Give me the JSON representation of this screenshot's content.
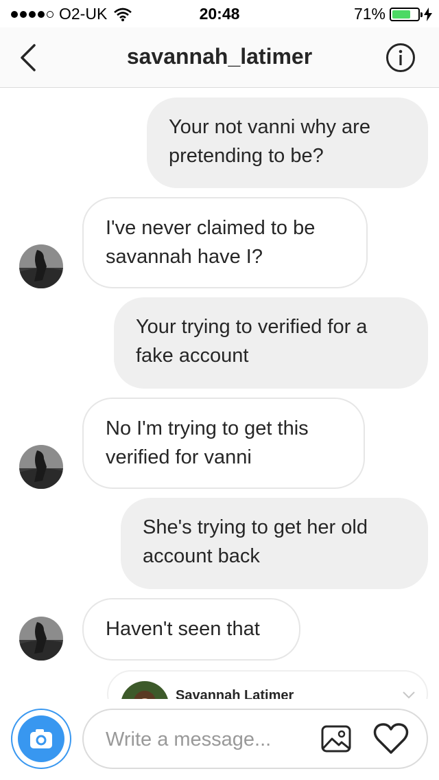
{
  "status_bar": {
    "carrier": "O2-UK",
    "time": "20:48",
    "battery_percent": "71%",
    "battery_level": 0.71,
    "signal_bars": 4
  },
  "header": {
    "title": "savannah_latimer",
    "back_icon": "chevron-left-icon",
    "info_icon": "info-icon"
  },
  "messages": [
    {
      "direction": "out",
      "text_lines": [
        "Your not vanni why are",
        "pretending to be?"
      ]
    },
    {
      "direction": "in",
      "text_lines": [
        "I've never claimed to be",
        "savannah have I?"
      ]
    },
    {
      "direction": "out",
      "text_lines": [
        "Your trying to verified for a",
        "fake account"
      ]
    },
    {
      "direction": "in",
      "text_lines": [
        "No I'm trying to get this",
        "verified for vanni"
      ]
    },
    {
      "direction": "out",
      "text_lines": [
        "She's trying to get her old",
        "account back"
      ]
    },
    {
      "direction": "in",
      "text_lines": [
        "Haven't seen that"
      ]
    }
  ],
  "shared_profile": {
    "name": "Savannah Latimer"
  },
  "composer": {
    "placeholder": "Write a message...",
    "value": ""
  },
  "colors": {
    "accent_blue": "#3897f0",
    "outgoing_bubble": "#efefef",
    "battery_green": "#4cd964"
  }
}
